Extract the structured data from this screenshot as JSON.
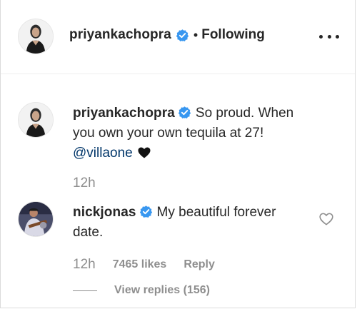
{
  "header": {
    "username": "priyankachopra",
    "separator": "•",
    "follow_state": "Following",
    "avatar_icon": "profile-photo-icon",
    "verified_icon": "verified-badge-icon",
    "more_icon": "more-options-icon"
  },
  "comments": [
    {
      "username": "priyankachopra",
      "verified": true,
      "text": "So proud. When you own your own tequila at 27!",
      "mention": "@villaone",
      "emoji": "black-heart-icon",
      "timestamp": "12h"
    },
    {
      "username": "nickjonas",
      "verified": true,
      "text": "My beautiful forever date.",
      "timestamp": "12h",
      "likes": "7465 likes",
      "reply_label": "Reply",
      "view_replies": "View replies (156)",
      "like_icon": "heart-outline-icon"
    }
  ],
  "colors": {
    "text": "#262626",
    "muted": "#8e8e8e",
    "mention": "#003569",
    "verified": "#3897f0",
    "border": "#dbdbdb"
  }
}
